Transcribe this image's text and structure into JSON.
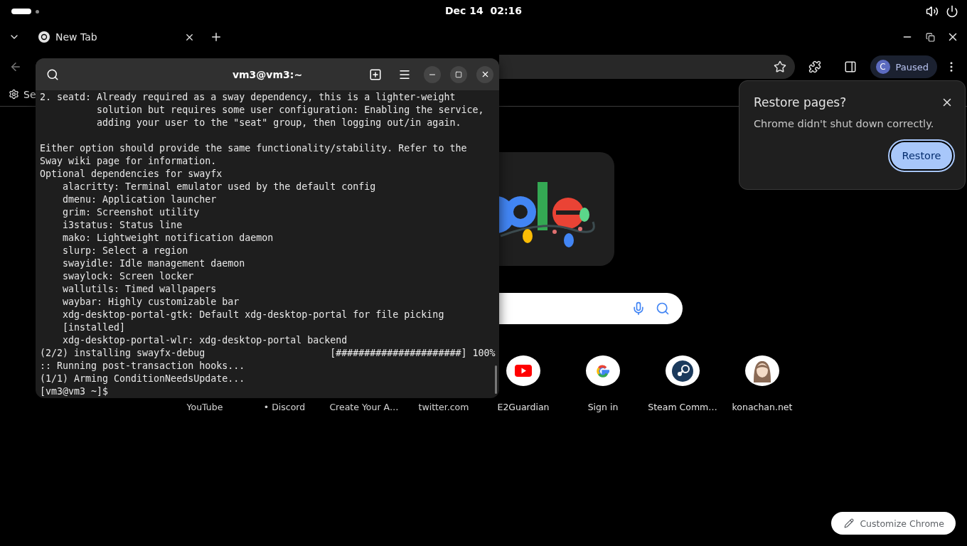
{
  "top_bar": {
    "clock": "Dec 14  02:16"
  },
  "browser": {
    "tabs": [
      {
        "label": "New Tab",
        "selected": true
      }
    ],
    "bookmarks": [
      {
        "label": "Se"
      }
    ],
    "profile": {
      "initial": "C",
      "status": "Paused"
    },
    "new_tab_page": {
      "shortcuts": [
        {
          "label": "YouTube",
          "kind": "caption"
        },
        {
          "label": "• Discord",
          "kind": "caption"
        },
        {
          "label": "Create Your A…",
          "kind": "caption"
        },
        {
          "label": "twitter.com",
          "kind": "caption"
        },
        {
          "label": "E2Guardian",
          "kind": "video"
        },
        {
          "label": "Sign in",
          "kind": "search"
        },
        {
          "label": "Steam Comm…",
          "kind": "game"
        },
        {
          "label": "konachan.net",
          "kind": "portrait"
        }
      ],
      "customize_button": "Customize Chrome"
    },
    "restore_popup": {
      "title": "Restore pages?",
      "message": "Chrome didn't shut down correctly.",
      "button": "Restore"
    }
  },
  "terminal": {
    "title": "vm3@vm3:~",
    "output": [
      [
        "2. seatd: Already required as a sway dependency, this is a lighter-weight",
        "          solution but requires some user configuration: Enabling the service,",
        "          adding your user to the \"seat\" group, then logging out/in again."
      ],
      [
        "Either option should provide the same functionality/stability. Refer to the",
        "Sway wiki page for information.",
        "Optional dependencies for swayfx",
        "    alacritty: Terminal emulator used by the default config",
        "    dmenu: Application launcher",
        "    grim: Screenshot utility",
        "    i3status: Status line",
        "    mako: Lightweight notification daemon",
        "    slurp: Select a region",
        "    swayidle: Idle management daemon",
        "    swaylock: Screen locker",
        "    wallutils: Timed wallpapers",
        "    waybar: Highly customizable bar",
        "    xdg-desktop-portal-gtk: Default xdg-desktop-portal for file picking",
        "    [installed]",
        "    xdg-desktop-portal-wlr: xdg-desktop-portal backend",
        "(2/2) installing swayfx-debug                      [######################] 100%",
        ":: Running post-transaction hooks...",
        "(1/1) Arming ConditionNeedsUpdate...",
        "[vm3@vm3 ~]$"
      ]
    ]
  }
}
